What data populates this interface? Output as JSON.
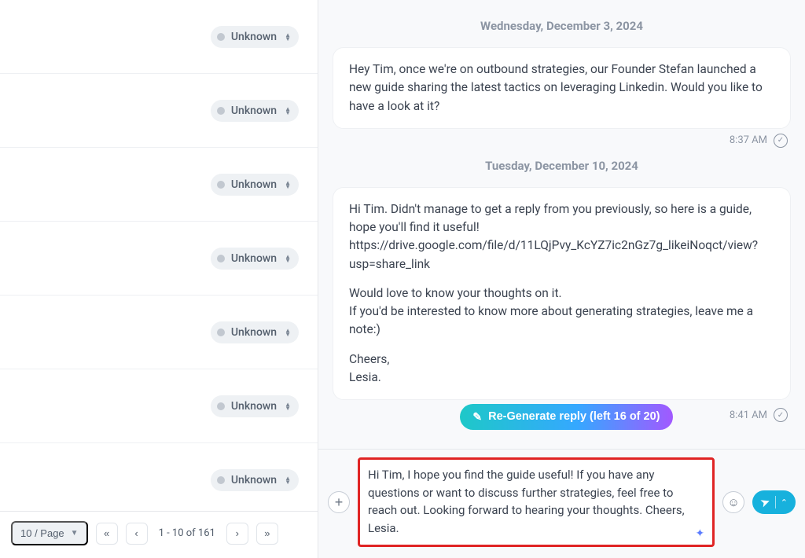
{
  "sidebar": {
    "rows": [
      {
        "status": "Unknown"
      },
      {
        "status": "Unknown"
      },
      {
        "status": "Unknown"
      },
      {
        "status": "Unknown"
      },
      {
        "status": "Unknown"
      },
      {
        "status": "Unknown"
      },
      {
        "status": "Unknown"
      }
    ],
    "pager": {
      "per_page_label": "10 / Page",
      "range_label": "1 - 10 of 161"
    }
  },
  "thread": {
    "groups": [
      {
        "date": "Wednesday, December 3, 2024",
        "messages": [
          {
            "paragraphs": [
              "Hey Tim, once we're on outbound strategies, our Founder Stefan launched a new guide sharing the latest tactics on leveraging Linkedin. Would you like to have a look at it?"
            ],
            "time": "8:37 AM",
            "regen": null
          }
        ]
      },
      {
        "date": "Tuesday, December 10, 2024",
        "messages": [
          {
            "paragraphs": [
              "Hi Tim. Didn't manage to get a reply from you previously, so here is a guide, hope you'll find it useful!\nhttps://drive.google.com/file/d/11LQjPvy_KcYZ7ic2nGz7g_likeiNoqct/view?usp=share_link",
              "Would love to know your thoughts on it.\nIf you'd be interested to know more about generating strategies, leave me a note:)",
              "Cheers,\nLesia."
            ],
            "time": "8:41 AM",
            "regen": "Re-Generate reply (left 16 of 20)"
          }
        ]
      }
    ]
  },
  "compose": {
    "draft": "Hi Tim, I hope you find the guide useful! If you have any questions or want to discuss further strategies, feel free to reach out. Looking forward to hearing your thoughts. Cheers, Lesia."
  }
}
